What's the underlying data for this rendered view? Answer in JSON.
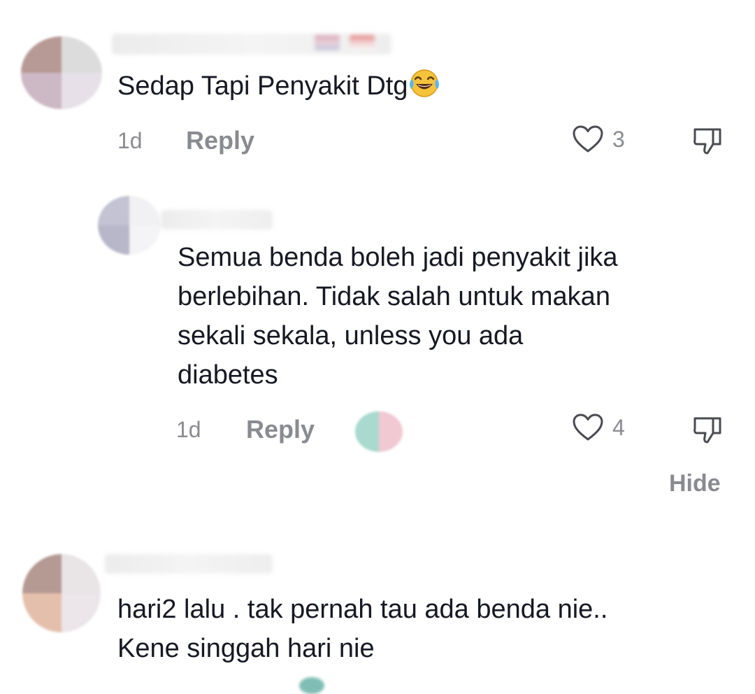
{
  "comments": [
    {
      "text_lines": [
        "Sedap Tapi Penyakit Dtg"
      ],
      "emoji": "face-with-tears-of-joy",
      "time": "1d",
      "reply_label": "Reply",
      "likes": "3",
      "avatar_colors": [
        "#b79a96",
        "#dcdcdc",
        "#cdb8c6",
        "#e7e0e8"
      ]
    },
    {
      "text_lines": [
        "Semua benda boleh jadi penyakit jika",
        "berlebihan. Tidak salah untuk makan",
        "sekali sekala, unless you ada",
        "diabetes"
      ],
      "time": "1d",
      "reply_label": "Reply",
      "likes": "4",
      "avatar_colors": [
        "#c3c3d3",
        "#f1f1f3",
        "#b7b7c9",
        "#f4f4f6"
      ],
      "creator_badge_colors": [
        "#a9d9cf",
        "#f0c9d2"
      ]
    },
    {
      "text_lines": [
        "hari2 lalu . tak pernah tau ada benda nie..",
        "Kene singgah hari nie"
      ],
      "avatar_colors": [
        "#b59993",
        "#e9e4e6",
        "#e4c0ac",
        "#ece6ea"
      ]
    }
  ],
  "hide_label": "Hide",
  "colors": {
    "text": "#161823",
    "secondary": "#8a8b91",
    "background": "#ffffff"
  }
}
